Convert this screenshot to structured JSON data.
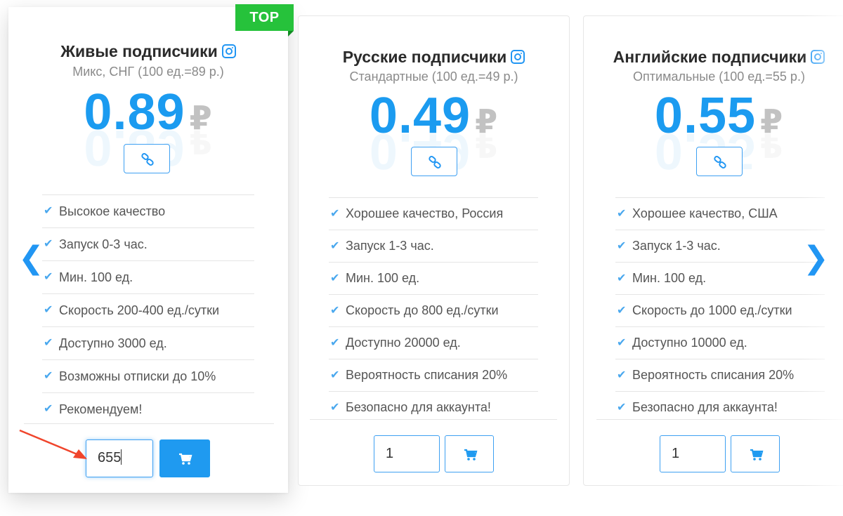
{
  "cards": [
    {
      "title": "Живые подписчики",
      "subtitle": "Микс, СНГ (100 ед.=89 р.)",
      "price": "0.89",
      "currency": "₽",
      "features": [
        "Высокое качество",
        "Запуск 0-3 час.",
        "Мин. 100 ед.",
        "Скорость 200-400 ед./сутки",
        "Доступно 3000 ед.",
        "Возможны отписки до 10%",
        "Рекомендуем!"
      ],
      "quantity": "655",
      "badge": "TOP"
    },
    {
      "title": "Русские подписчики",
      "subtitle": "Стандартные (100 ед.=49 р.)",
      "price": "0.49",
      "currency": "₽",
      "features": [
        "Хорошее качество, Россия",
        "Запуск 1-3 час.",
        "Мин. 100 ед.",
        "Скорость до 800 ед./сутки",
        "Доступно 20000 ед.",
        "Вероятность списания 20%",
        "Безопасно для аккаунта!"
      ],
      "quantity": "1"
    },
    {
      "title": "Английские подписчики",
      "subtitle": "Оптимальные (100 ед.=55 р.)",
      "price": "0.55",
      "currency": "₽",
      "features": [
        "Хорошее качество, США",
        "Запуск 1-3 час.",
        "Мин. 100 ед.",
        "Скорость до 1000 ед./сутки",
        "Доступно 10000 ед.",
        "Вероятность списания 20%",
        "Безопасно для аккаунта!"
      ],
      "quantity": "1"
    }
  ],
  "nav": {
    "prev": "❮",
    "next": "❯"
  },
  "icons": {
    "title": "instagram-icon",
    "link": "link-icon",
    "cart": "cart-icon",
    "check": "check-icon"
  },
  "colors": {
    "accent": "#1b9bf0",
    "badge": "#26c23b",
    "arrow_annotation": "#f0452c"
  }
}
